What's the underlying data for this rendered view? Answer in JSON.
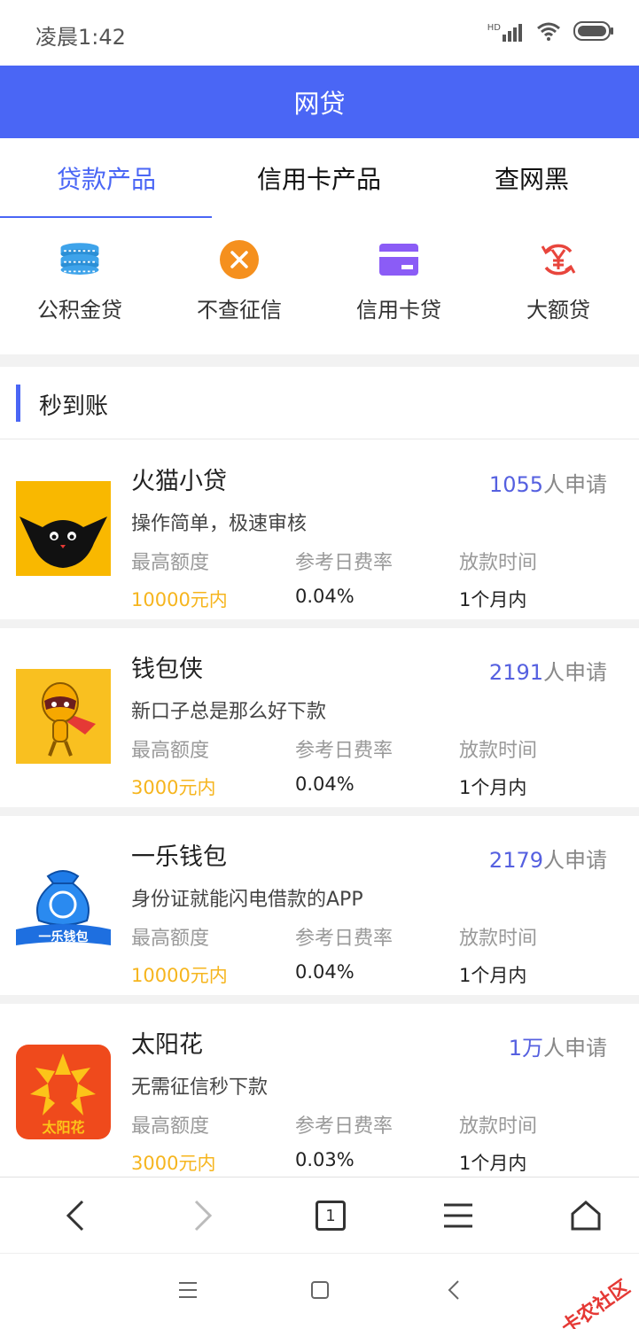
{
  "status_bar": {
    "time": "凌晨1:42",
    "hd": "HD"
  },
  "header": {
    "title": "网贷"
  },
  "tabs": [
    {
      "label": "贷款产品",
      "active": true
    },
    {
      "label": "信用卡产品",
      "active": false
    },
    {
      "label": "查网黑",
      "active": false
    }
  ],
  "categories": [
    {
      "label": "公积金贷",
      "icon": "coins-icon",
      "color": "#3ea3ea"
    },
    {
      "label": "不查征信",
      "icon": "close-circle-icon",
      "color": "#f5901e"
    },
    {
      "label": "信用卡贷",
      "icon": "credit-card-icon",
      "color": "#8b5cf6"
    },
    {
      "label": "大额贷",
      "icon": "yuan-icon",
      "color": "#e8453c"
    }
  ],
  "section": {
    "title": "秒到账"
  },
  "loans": [
    {
      "name": "火猫小贷",
      "apply_count": "1055",
      "apply_suffix": "人申请",
      "desc": "操作简单，极速审核",
      "max_label": "最高额度",
      "max_value": "10000元内",
      "rate_label": "参考日费率",
      "rate_value": "0.04%",
      "time_label": "放款时间",
      "time_value": "1个月内",
      "logo": "black-cat-logo"
    },
    {
      "name": "钱包侠",
      "apply_count": "2191",
      "apply_suffix": "人申请",
      "desc": "新口子总是那么好下款",
      "max_label": "最高额度",
      "max_value": "3000元内",
      "rate_label": "参考日费率",
      "rate_value": "0.04%",
      "time_label": "放款时间",
      "time_value": "1个月内",
      "logo": "hero-logo"
    },
    {
      "name": "一乐钱包",
      "apply_count": "2179",
      "apply_suffix": "人申请",
      "desc": "身份证就能闪电借款的APP",
      "max_label": "最高额度",
      "max_value": "10000元内",
      "rate_label": "参考日费率",
      "rate_value": "0.04%",
      "time_label": "放款时间",
      "time_value": "1个月内",
      "logo": "money-bag-logo",
      "logo_text": "一乐钱包"
    },
    {
      "name": "太阳花",
      "apply_count": "1万",
      "apply_suffix": "人申请",
      "desc": "无需征信秒下款",
      "max_label": "最高额度",
      "max_value": "3000元内",
      "rate_label": "参考日费率",
      "rate_value": "0.03%",
      "time_label": "放款时间",
      "time_value": "1个月内",
      "logo": "sunflower-logo",
      "logo_text": "太阳花"
    }
  ],
  "browser": {
    "tab_count": "1"
  },
  "watermark": "卡农社区",
  "colors": {
    "accent": "#4a66f5",
    "amount": "#f6b51e",
    "apply_num": "#5560e0"
  }
}
